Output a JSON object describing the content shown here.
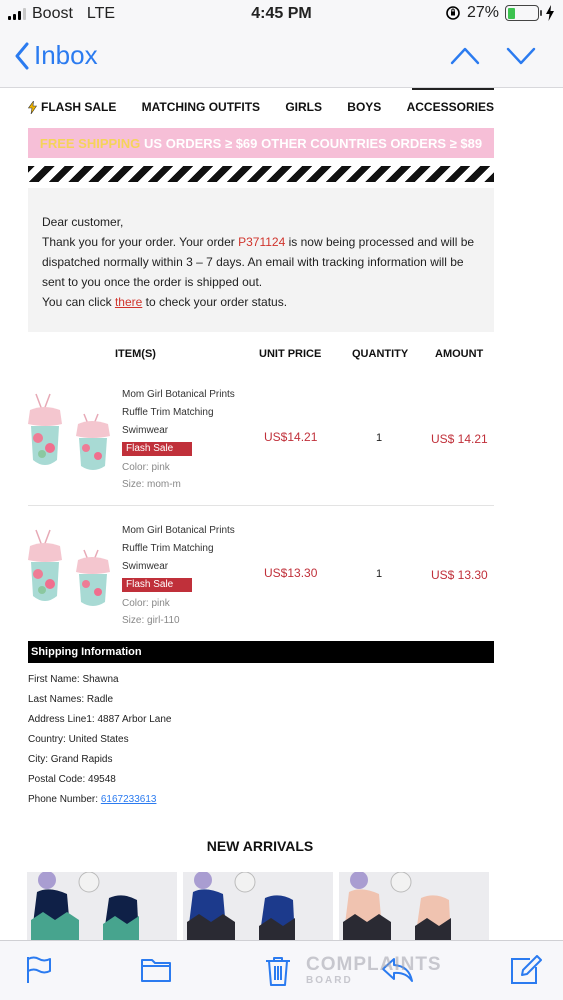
{
  "status_bar": {
    "carrier": "Boost",
    "network": "LTE",
    "time": "4:45 PM",
    "battery": "27%"
  },
  "nav": {
    "back_label": "Inbox"
  },
  "menu": [
    "FLASH SALE",
    "MATCHING OUTFITS",
    "GIRLS",
    "BOYS",
    "ACCESSORIES"
  ],
  "promo": {
    "free": "FREE SHIPPING",
    "us": "US ORDERS ≥ $69",
    "other": "OTHER COUNTRIES ORDERS ≥ $89"
  },
  "message": {
    "greeting": "Dear customer,",
    "line1_a": "Thank you for your order. Your order ",
    "order_number": "P371124",
    "line1_b": " is now being processed and will be dispatched normally within 3 – 7 days. An email with tracking information will be sent to you once the order is shipped out.",
    "line2_a": "You can click ",
    "link_text": "there",
    "line2_b": " to check your order status."
  },
  "table": {
    "headers": [
      "ITEM(S)",
      "UNIT PRICE",
      "QUANTITY",
      "AMOUNT"
    ],
    "items": [
      {
        "name": "Mom Girl Botanical Prints Ruffle Trim Matching Swimwear",
        "badge": "Flash Sale",
        "color": "Color: pink",
        "size": "Size: mom-m",
        "unit_price": "US$14.21",
        "quantity": "1",
        "amount": "US$ 14.21"
      },
      {
        "name": "Mom Girl Botanical Prints Ruffle Trim Matching Swimwear",
        "badge": "Flash Sale",
        "color": "Color: pink",
        "size": "Size: girl-110",
        "unit_price": "US$13.30",
        "quantity": "1",
        "amount": "US$ 13.30"
      }
    ]
  },
  "shipping": {
    "title": "Shipping Information",
    "first_name": "First Name: Shawna",
    "last_name": "Last Names: Radle",
    "address": "Address Line1: 4887 Arbor Lane",
    "country": "Country: United States",
    "city": "City: Grand Rapids",
    "postal": "Postal Code: 49548",
    "phone_label": "Phone Number: ",
    "phone": "6167233613"
  },
  "new_arrivals": "NEW ARRIVALS",
  "watermark": {
    "line1": "COMPLAINTS",
    "line2": "BOARD"
  },
  "colors": {
    "accent_blue": "#2b7bf0",
    "sale_red": "#c0303a",
    "promo_pink": "#f6bfd7"
  }
}
